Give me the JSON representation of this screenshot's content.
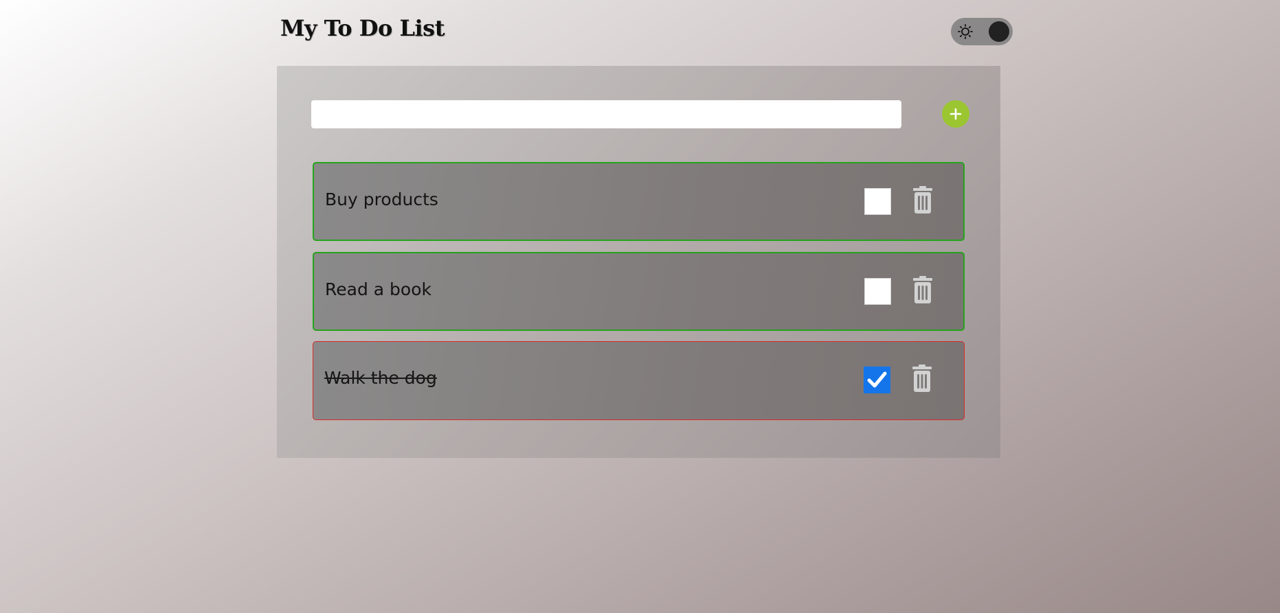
{
  "header": {
    "title": "My To Do List",
    "theme_toggle": {
      "icon": "sun-icon",
      "mode": "light"
    }
  },
  "new_task": {
    "value": "",
    "placeholder": "",
    "add_icon": "plus-icon"
  },
  "tasks": [
    {
      "text": "Buy products",
      "completed": false
    },
    {
      "text": "Read a book",
      "completed": false
    },
    {
      "text": "Walk the dog",
      "completed": true
    }
  ],
  "colors": {
    "add_button": "#9bc631",
    "active_border": "#26a31c",
    "done_border": "#d42a2a",
    "checkbox_checked": "#1475ea"
  }
}
